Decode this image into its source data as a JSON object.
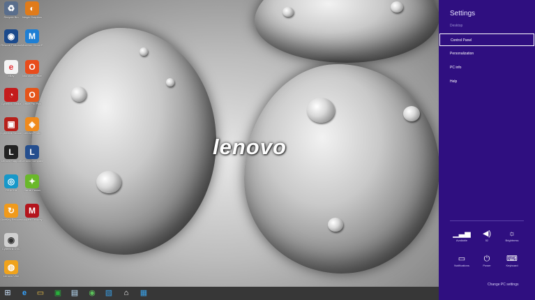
{
  "desktop": {
    "logo_text": "lenovo",
    "icons": [
      {
        "name": "recycle-bin",
        "label": "Recycle Bin",
        "glyph": "♻",
        "color": "#5a6e8c"
      },
      {
        "name": "magic-graphics",
        "label": "Magic Graphics",
        "glyph": "◐",
        "color": "#e07b1a"
      },
      {
        "name": "rescue-podcast",
        "label": "Rescue Podcast",
        "glyph": "◉",
        "color": "#1b4a8c"
      },
      {
        "name": "maxthon",
        "label": "Maxthon Cloud Bro",
        "glyph": "M",
        "color": "#1e7fd4"
      },
      {
        "name": "ebay",
        "label": "eBay",
        "glyph": "e",
        "color": "#f4f4f4"
      },
      {
        "name": "office",
        "label": "Microsoft Office",
        "glyph": "O",
        "color": "#e84c1c"
      },
      {
        "name": "cyberlink",
        "label": "Cyberlink Media",
        "glyph": "◔",
        "color": "#c41c1c"
      },
      {
        "name": "office-2",
        "label": "Office Pro Plus",
        "glyph": "O",
        "color": "#e5551a"
      },
      {
        "name": "camera",
        "label": "Cyberlink Youcam",
        "glyph": "▣",
        "color": "#b7201a"
      },
      {
        "name": "photo-app",
        "label": "Lenovo Photo",
        "glyph": "◈",
        "color": "#f08a1c"
      },
      {
        "name": "lenovo-app",
        "label": "Lenovo Support",
        "glyph": "L",
        "color": "#222"
      },
      {
        "name": "lenovo-app-2",
        "label": "Lenovo Companion",
        "glyph": "L",
        "color": "#244e8e"
      },
      {
        "name": "reach-it",
        "label": "REACHit",
        "glyph": "◎",
        "color": "#1798c9"
      },
      {
        "name": "game",
        "label": "Game Center",
        "glyph": "✦",
        "color": "#6ab82a"
      },
      {
        "name": "onekey",
        "label": "OneKey Recovery",
        "glyph": "↻",
        "color": "#f09a1c"
      },
      {
        "name": "mcafee",
        "label": "McAfee Security",
        "glyph": "M",
        "color": "#b4141c"
      },
      {
        "name": "dvd",
        "label": "Cyberlink DVD",
        "glyph": "◉",
        "color": "#d0d0d0"
      },
      {
        "name": "vibe",
        "label": "Lenovo Vibe",
        "glyph": "◍",
        "color": "#f0a31c"
      }
    ]
  },
  "taskbar": {
    "items": [
      {
        "name": "start",
        "glyph": "⊞"
      },
      {
        "name": "internet-explorer",
        "glyph": "e"
      },
      {
        "name": "file-explorer",
        "glyph": "▭"
      },
      {
        "name": "store",
        "glyph": "▣"
      },
      {
        "name": "monitor",
        "glyph": "▤"
      },
      {
        "name": "media",
        "glyph": "◉"
      },
      {
        "name": "app",
        "glyph": "▧"
      },
      {
        "name": "home",
        "glyph": "⌂"
      },
      {
        "name": "window",
        "glyph": "▦"
      }
    ]
  },
  "charm": {
    "title": "Settings",
    "subtitle": "Desktop",
    "menu": [
      {
        "name": "control-panel",
        "label": "Control Panel"
      },
      {
        "name": "personalization",
        "label": "Personalization"
      },
      {
        "name": "pc-info",
        "label": "PC info"
      },
      {
        "name": "help",
        "label": "Help"
      }
    ],
    "tiles": [
      {
        "name": "available",
        "label": "Available",
        "glyph": "📶"
      },
      {
        "name": "volume",
        "label": "52",
        "glyph": "🔊"
      },
      {
        "name": "brightness",
        "label": "Brightness",
        "glyph": "☼"
      },
      {
        "name": "notifications",
        "label": "Notifications",
        "glyph": "▭"
      },
      {
        "name": "power",
        "label": "Power",
        "glyph": "⏻"
      },
      {
        "name": "keyboard",
        "label": "Keyboard",
        "glyph": "⌨"
      }
    ],
    "change_pc_settings": "Change PC settings"
  },
  "colors": {
    "charm_bg": "#2f0f80",
    "accent_text": "#d8d2f5"
  }
}
